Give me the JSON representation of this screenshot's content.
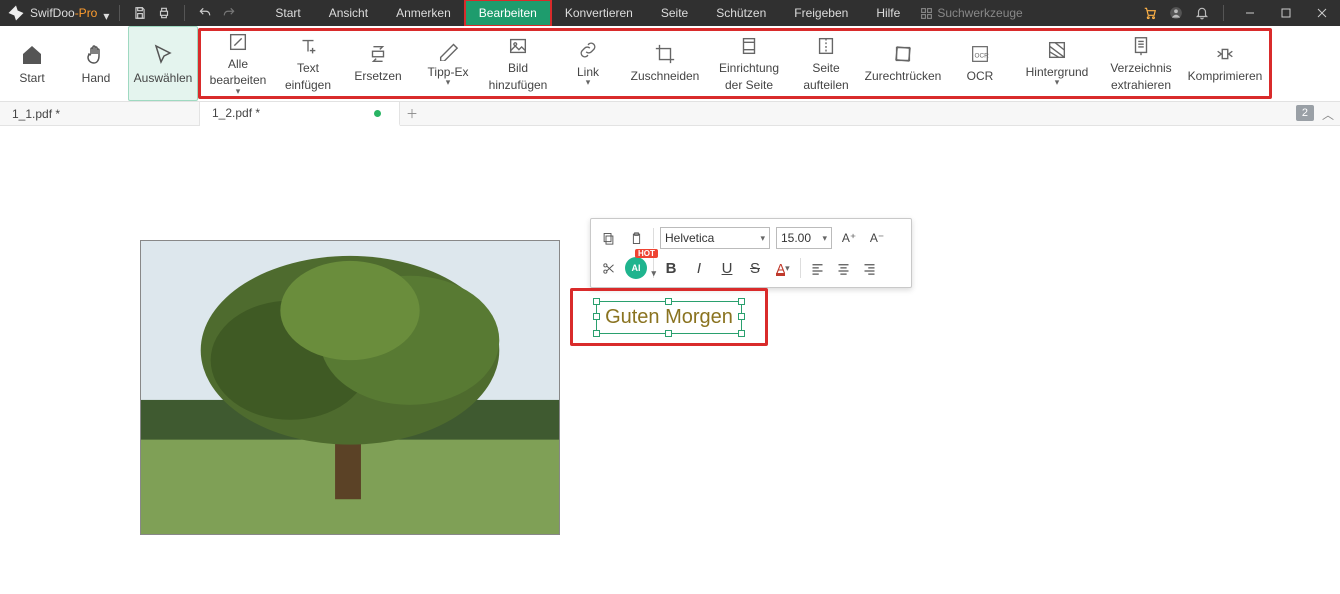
{
  "app": {
    "name_a": "SwifDoo",
    "name_b": "-Pro"
  },
  "menu": {
    "items": [
      "Start",
      "Ansicht",
      "Anmerken",
      "Bearbeiten",
      "Konvertieren",
      "Seite",
      "Schützen",
      "Freigeben",
      "Hilfe"
    ],
    "active_index": 3,
    "search_tools": "Suchwerkzeuge"
  },
  "left_tools": {
    "start": "Start",
    "hand": "Hand",
    "select": "Auswählen"
  },
  "ribbon": {
    "t0a": "Alle",
    "t0b": "bearbeiten",
    "t1a": "Text",
    "t1b": "einfügen",
    "t2": "Ersetzen",
    "t3": "Tipp-Ex",
    "t4a": "Bild",
    "t4b": "hinzufügen",
    "t5": "Link",
    "t6": "Zuschneiden",
    "t7a": "Einrichtung",
    "t7b": "der Seite",
    "t8a": "Seite",
    "t8b": "aufteilen",
    "t9": "Zurechtrücken",
    "t10": "OCR",
    "t11": "Hintergrund",
    "t12a": "Verzeichnis",
    "t12b": "extrahieren",
    "t13": "Komprimieren"
  },
  "tabs": {
    "tab0": "1_1.pdf *",
    "tab1": "1_2.pdf *",
    "page_badge": "2"
  },
  "textbox": {
    "text": "Guten Morgen"
  },
  "fmt": {
    "font": "Helvetica",
    "size": "15.00",
    "ai": "AI",
    "hot": "HOT",
    "Aplus": "A⁺",
    "Aminus": "A⁻",
    "B": "B",
    "I": "I",
    "U": "U",
    "S": "S",
    "Acolor": "A"
  }
}
